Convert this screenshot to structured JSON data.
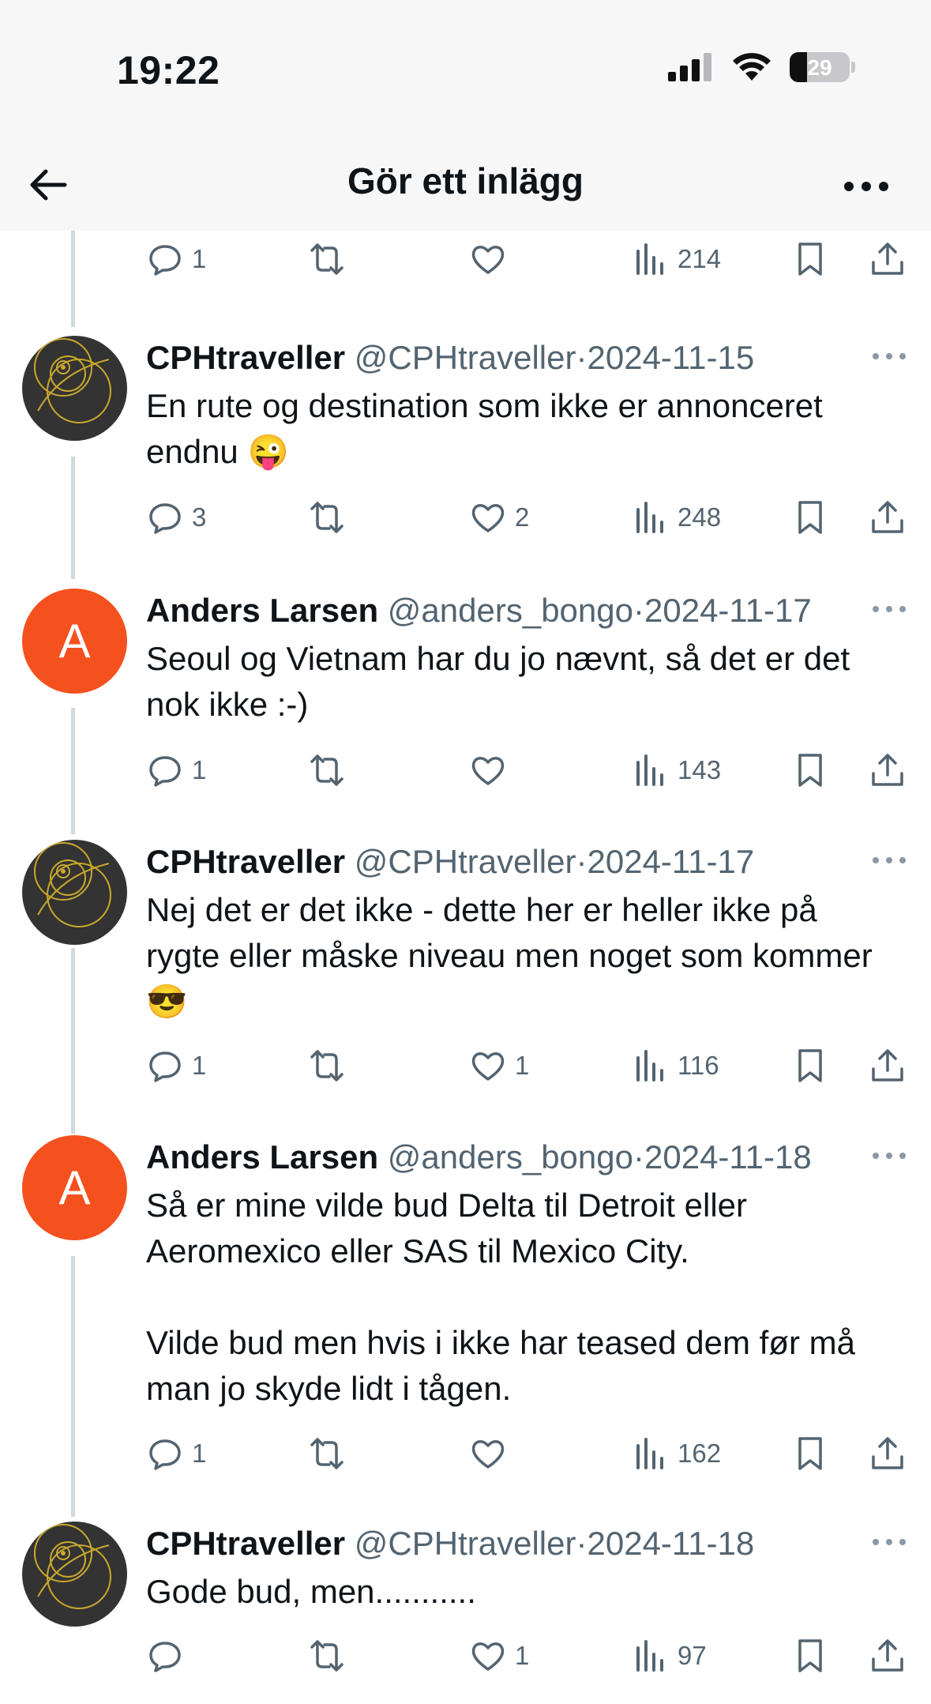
{
  "status": {
    "time": "19:22",
    "battery_level": "29"
  },
  "nav": {
    "title": "Gör ett inlägg"
  },
  "top_actions": {
    "replies": "1",
    "views": "214"
  },
  "tweets": [
    {
      "name": "CPHtraveller",
      "handle": "@CPHtraveller",
      "sep": "·",
      "date": "2024-11-15",
      "avatar": "logo",
      "lines": [
        "En rute og destination som ikke er annonceret endnu 😜"
      ],
      "replies": "3",
      "likes": "2",
      "views": "248"
    },
    {
      "name": "Anders Larsen",
      "handle": "@anders_bongo",
      "sep": "·",
      "date": "2024-11-17",
      "avatar": "letter",
      "initial": "A",
      "lines": [
        "Seoul  og Vietnam har du jo nævnt, så det er det nok ikke :-)"
      ],
      "replies": "1",
      "likes": "",
      "views": "143"
    },
    {
      "name": "CPHtraveller",
      "handle": "@CPHtraveller",
      "sep": "·",
      "date": "2024-11-17",
      "avatar": "logo",
      "lines": [
        "Nej det er det ikke - dette her er heller ikke på rygte eller måske niveau men noget som kommer 😎"
      ],
      "replies": "1",
      "likes": "1",
      "views": "116"
    },
    {
      "name": "Anders Larsen",
      "handle": "@anders_bongo",
      "sep": "·",
      "date": "2024-11-18",
      "avatar": "letter",
      "initial": "A",
      "lines": [
        "Så er mine vilde bud Delta til Detroit eller Aeromexico eller SAS til Mexico City.",
        "Vilde bud men hvis i ikke har teased dem før må man jo skyde lidt i tågen."
      ],
      "replies": "1",
      "likes": "",
      "views": "162"
    },
    {
      "name": "CPHtraveller",
      "handle": "@CPHtraveller",
      "sep": "·",
      "date": "2024-11-18",
      "avatar": "logo",
      "lines": [
        "Gode bud, men..........."
      ],
      "replies": "",
      "likes": "1",
      "views": "97"
    }
  ]
}
